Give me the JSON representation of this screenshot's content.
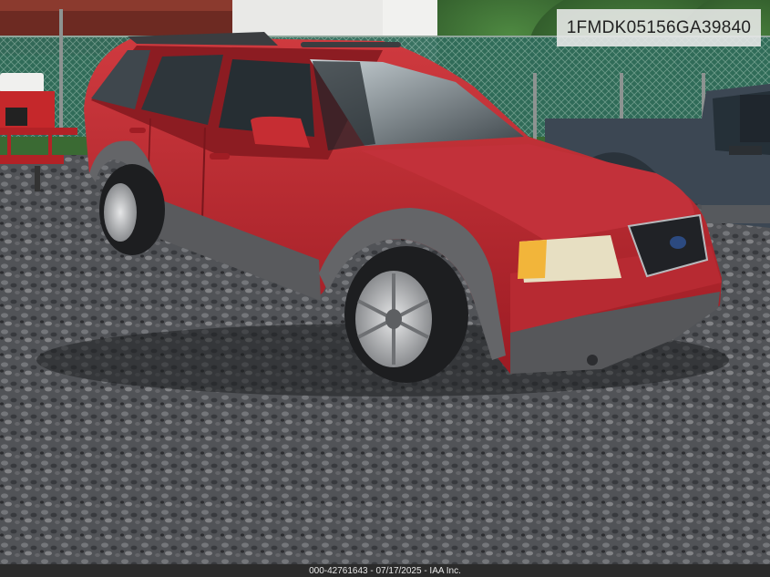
{
  "vin_label": "1FMDK05156GA39840",
  "footer_text": "000-42761643 - 07/17/2025 - IAA Inc.",
  "colors": {
    "vehicle_body": "#b8232c",
    "vehicle_trim": "#5a5b5d",
    "truck_body": "#3f4a55",
    "gravel": "#5c5e62",
    "foliage": "#3f6f35"
  }
}
